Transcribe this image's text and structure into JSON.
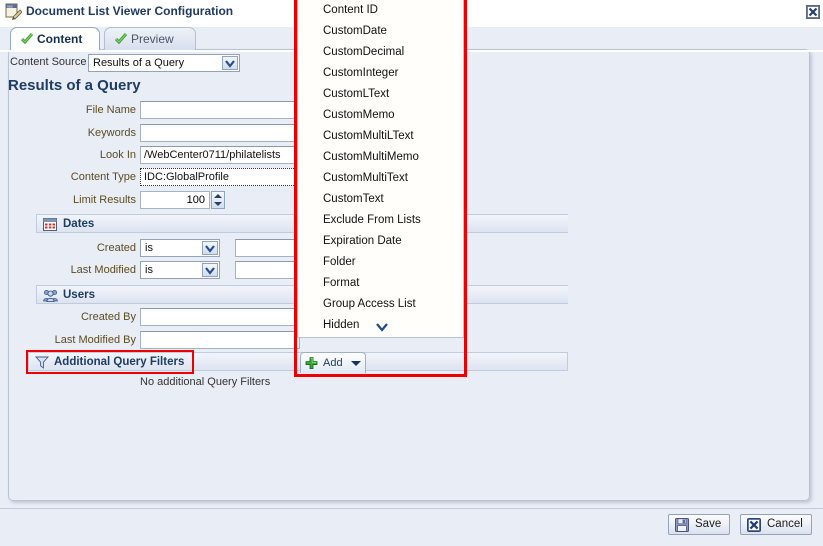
{
  "window": {
    "title": "Document List Viewer Configuration",
    "title_icon": "document-properties-icon",
    "close_icon": "close-icon"
  },
  "tabs": [
    {
      "label": "Content",
      "icon": "check-icon",
      "active": true
    },
    {
      "label": "Preview",
      "icon": "check-icon",
      "active": false
    }
  ],
  "content_source": {
    "label": "Content Source",
    "value": "Results of a Query",
    "arrow_icon": "chevron-down-icon"
  },
  "section": {
    "heading": "Results of a Query"
  },
  "fields": {
    "file_name": {
      "label": "File Name",
      "value": ""
    },
    "keywords": {
      "label": "Keywords",
      "value": ""
    },
    "look_in": {
      "label": "Look In",
      "value": "/WebCenter0711/philatelists"
    },
    "content_type": {
      "label": "Content Type",
      "value": "IDC:GlobalProfile"
    },
    "limit_results": {
      "label": "Limit Results",
      "value": "100",
      "spinner_icon": "spinner-up-down-icon"
    }
  },
  "dates_group": {
    "title": "Dates",
    "icon": "calendar-icon",
    "rows": [
      {
        "label": "Created",
        "condition": "is",
        "value": ""
      },
      {
        "label": "Last Modified",
        "condition": "is",
        "value": ""
      }
    ]
  },
  "users_group": {
    "title": "Users",
    "icon": "users-icon",
    "rows": [
      {
        "label": "Created By",
        "value": ""
      },
      {
        "label": "Last Modified By",
        "value": ""
      }
    ]
  },
  "additional_query_filters": {
    "title": "Additional Query Filters",
    "icon": "filter-icon",
    "empty_text": "No additional Query Filters",
    "highlight_color": "#ee0000"
  },
  "add_button": {
    "label": "Add",
    "plus_icon": "plus-icon",
    "caret_icon": "caret-down-icon"
  },
  "dropdown": {
    "highlight_color": "#ee0000",
    "scroll_icon": "chevron-down-icon",
    "items": [
      "Content ID",
      "CustomDate",
      "CustomDecimal",
      "CustomInteger",
      "CustomLText",
      "CustomMemo",
      "CustomMultiLText",
      "CustomMultiMemo",
      "CustomMultiText",
      "CustomText",
      "Exclude From Lists",
      "Expiration Date",
      "Folder",
      "Format",
      "Group Access List",
      "Hidden"
    ]
  },
  "footer": {
    "save": {
      "label": "Save",
      "icon": "save-disk-icon"
    },
    "cancel": {
      "label": "Cancel",
      "icon": "cancel-x-icon"
    }
  }
}
